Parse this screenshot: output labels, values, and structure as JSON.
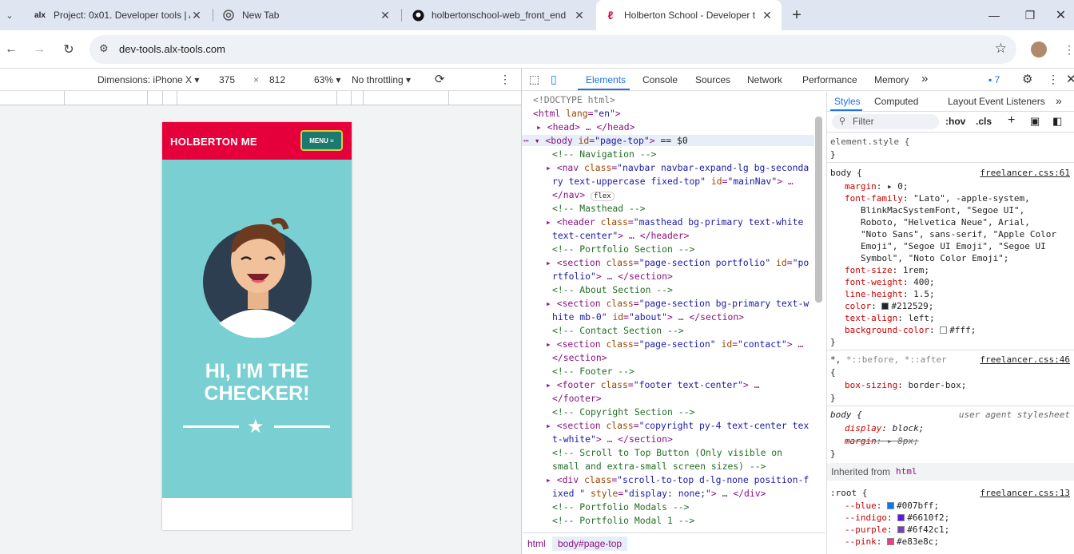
{
  "browser": {
    "tabs": [
      {
        "title": "Project: 0x01. Developer tools | A",
        "favicon": "alx-logo",
        "close": "✕"
      },
      {
        "title": "New Tab",
        "favicon": "chrome-icon",
        "close": "✕"
      },
      {
        "title": "holbertonschool-web_front_end",
        "favicon": "github-icon",
        "close": "✕"
      },
      {
        "title": "Holberton School - Developer t",
        "favicon": "holberton-icon",
        "close": "✕"
      }
    ],
    "new_tab": "+",
    "url": "dev-tools.alx-tools.com"
  },
  "device_toolbar": {
    "dimensions": "Dimensions: iPhone X",
    "width": "375",
    "x": "×",
    "height": "812",
    "zoom": "63%",
    "throttle": "No throttling"
  },
  "site": {
    "brand": "HOLBERTON ME",
    "menu": "MENU ≡",
    "heading_line1": "HI, I'M THE",
    "heading_line2": "CHECKER!"
  },
  "devtools": {
    "panels": [
      "Elements",
      "Console",
      "Sources",
      "Network",
      "Performance",
      "Memory"
    ],
    "more": "»",
    "issues": "7",
    "breadcrumb": [
      "html",
      "body#page-top"
    ]
  },
  "styles": {
    "tabs": [
      "Styles",
      "Computed",
      "Layout",
      "Event Listeners",
      "»"
    ],
    "filter_placeholder": "Filter",
    "hov": ":hov",
    "cls": ".cls",
    "inherited_label": "Inherited from",
    "inherited_from": "html"
  }
}
